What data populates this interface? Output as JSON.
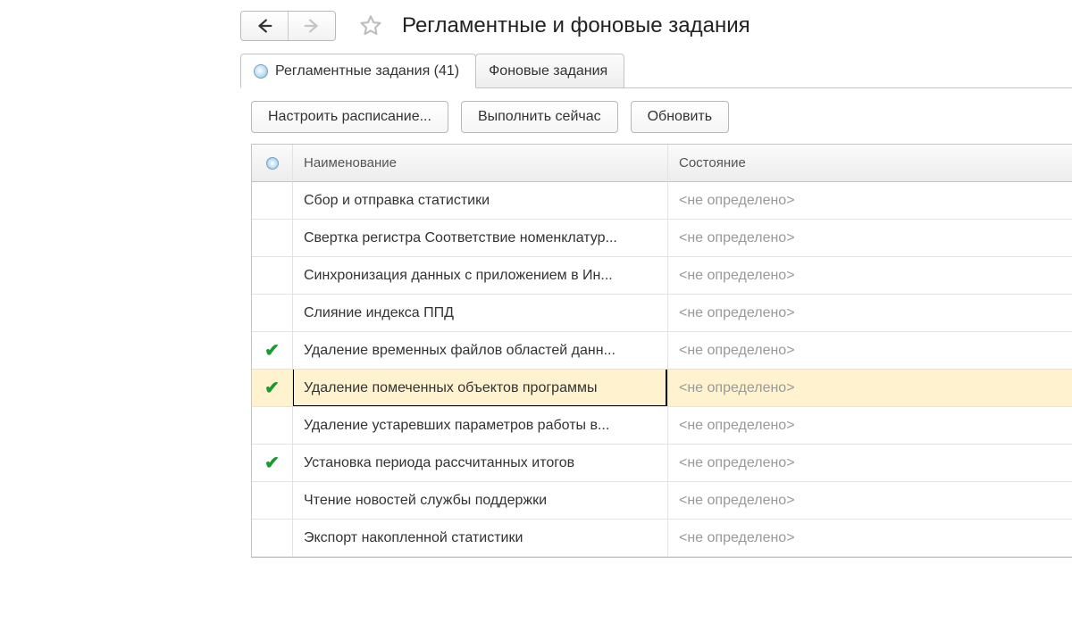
{
  "title": "Регламентные и фоновые задания",
  "tabs": {
    "scheduled": "Регламентные задания (41)",
    "background": "Фоновые задания"
  },
  "toolbar": {
    "schedule": "Настроить расписание...",
    "run_now": "Выполнить сейчас",
    "refresh": "Обновить"
  },
  "columns": {
    "name": "Наименование",
    "state": "Состояние"
  },
  "state_placeholder": "<не определено>",
  "rows": [
    {
      "check": false,
      "selected": false,
      "name": "Сбор и отправка статистики"
    },
    {
      "check": false,
      "selected": false,
      "name": "Свертка регистра Соответствие номенклатур..."
    },
    {
      "check": false,
      "selected": false,
      "name": "Синхронизация данных с приложением в Ин..."
    },
    {
      "check": false,
      "selected": false,
      "name": "Слияние индекса ППД"
    },
    {
      "check": true,
      "selected": false,
      "name": "Удаление временных файлов областей данн..."
    },
    {
      "check": true,
      "selected": true,
      "name": "Удаление помеченных объектов программы"
    },
    {
      "check": false,
      "selected": false,
      "name": "Удаление устаревших параметров работы в..."
    },
    {
      "check": true,
      "selected": false,
      "name": "Установка периода рассчитанных итогов"
    },
    {
      "check": false,
      "selected": false,
      "name": "Чтение новостей службы поддержки"
    },
    {
      "check": false,
      "selected": false,
      "name": "Экспорт накопленной статистики"
    }
  ]
}
